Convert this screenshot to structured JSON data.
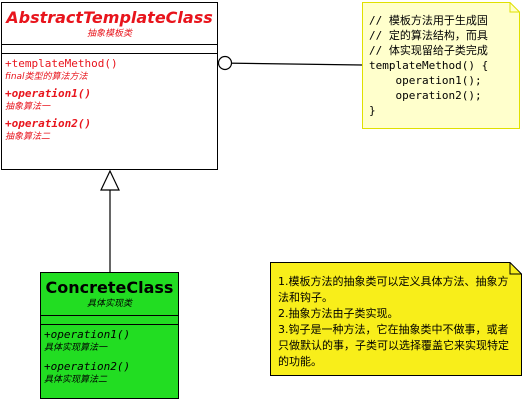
{
  "abstract_class": {
    "name": "AbstractTemplateClass",
    "stereotype": "抽象模板类",
    "operations": [
      {
        "signature": "+templateMethod()",
        "description": "final类型的算法方法"
      },
      {
        "signature": "+operation1()",
        "description": "抽象算法一"
      },
      {
        "signature": "+operation2()",
        "description": "抽象算法二"
      }
    ]
  },
  "concrete_class": {
    "name": "ConcreteClass",
    "stereotype": "具体实现类",
    "operations": [
      {
        "signature": "+operation1()",
        "description": "具体实现算法一"
      },
      {
        "signature": "+operation2()",
        "description": "具体实现算法二"
      }
    ]
  },
  "code_note": {
    "text": "// 模板方法用于生成固\n// 定的算法结构，而具\n// 体实现留给子类完成\ntemplateMethod() {\n    operation1();\n    operation2();\n}"
  },
  "description_note": {
    "text": "1.模板方法的抽象类可以定义具体方法、抽象方法和钩子。\n2.抽象方法由子类实现。\n3.钩子是一种方法，它在抽象类中不做事，或者只做默认的事，子类可以选择覆盖它来实现特定的功能。"
  },
  "colors": {
    "abstract_text": "#e8141c",
    "concrete_fill": "#22dd22",
    "note_fill_code": "#ffffcc",
    "note_border_code": "#e0e000",
    "note_fill_desc": "#f8ee1a",
    "note_border_desc": "#000000"
  }
}
